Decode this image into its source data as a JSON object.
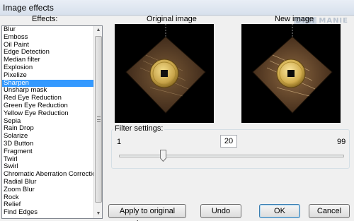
{
  "window": {
    "title": "Image effects"
  },
  "watermark": {
    "part1": "DIGI",
    "part2": "MANIE"
  },
  "effects": {
    "label": "Effects:",
    "items": [
      "Blur",
      "Emboss",
      "Oil Paint",
      "Edge Detection",
      "Median filter",
      "Explosion",
      "Pixelize",
      "Sharpen",
      "Unsharp mask",
      "Red Eye Reduction",
      "Green Eye Reduction",
      "Yellow Eye Reduction",
      "Sepia",
      "Rain Drop",
      "Solarize",
      "3D Button",
      "Fragment",
      "Twirl",
      "Swirl",
      "Chromatic Aberration Correction",
      "Radial Blur",
      "Zoom Blur",
      "Rock",
      "Relief",
      "Find Edges"
    ],
    "selected": "Sharpen"
  },
  "preview": {
    "original_label": "Original image",
    "new_label": "New image"
  },
  "filter": {
    "label": "Filter settings:",
    "min": "1",
    "max": "99",
    "value": "20",
    "value_fraction": 0.196
  },
  "buttons": {
    "apply": "Apply to original image",
    "undo": "Undo",
    "ok": "OK",
    "cancel": "Cancel"
  },
  "colors": {
    "selection": "#3399ff",
    "window_bg": "#f0f0f0"
  },
  "icons": {
    "scroll_up": "scroll-up-arrow",
    "scroll_down": "scroll-down-arrow",
    "slider_thumb": "slider-thumb"
  }
}
